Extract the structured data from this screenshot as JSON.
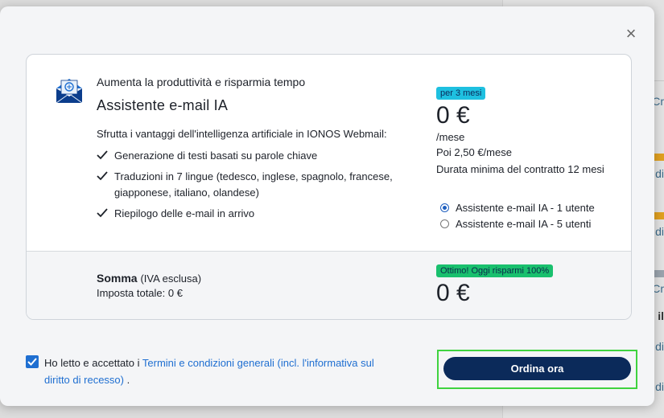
{
  "modal": {
    "close_symbol": "×"
  },
  "product": {
    "subtitle": "Aumenta la produttività e risparmia tempo",
    "title": "Assistente e-mail IA",
    "intro": "Sfrutta i vantaggi dell'intelligenza artificiale in IONOS Webmail:",
    "features": [
      "Generazione di testi basati su parole chiave",
      "Traduzioni in 7 lingue (tedesco, inglese, spagnolo, francese, giapponese, italiano, olandese)",
      "Riepilogo delle e-mail in arrivo"
    ],
    "icon": "mail-ai-icon"
  },
  "pricing": {
    "promo_badge": "per 3 mesi",
    "price": "0 €",
    "unit": "/mese",
    "after": "Poi 2,50 €/mese",
    "min_duration": "Durata minima del contratto 12 mesi",
    "options": [
      {
        "label": "Assistente e-mail IA - 1 utente",
        "selected": true
      },
      {
        "label": "Assistente e-mail IA - 5 utenti",
        "selected": false
      }
    ]
  },
  "summary": {
    "label": "Somma",
    "note": "(IVA esclusa)",
    "tax": "Imposta totale: 0 €",
    "save_badge": "Ottimo! Oggi risparmi 100%",
    "total": "0 €"
  },
  "terms": {
    "checked": true,
    "text_before": "Ho letto e accettato i ",
    "link": "Termini e condizioni generali (incl. l'informativa sul diritto di recesso)",
    "text_after": " ."
  },
  "order_button": "Ordina ora",
  "background": {
    "fragments": [
      "Cr",
      "di",
      "di",
      "Cr",
      "il",
      "di",
      "di"
    ]
  },
  "colors": {
    "primary": "#0b2a5a",
    "link": "#1f6fd1",
    "promo_badge": "#1ec0e0",
    "save_badge": "#19c06e",
    "highlight": "#3fd33f"
  }
}
